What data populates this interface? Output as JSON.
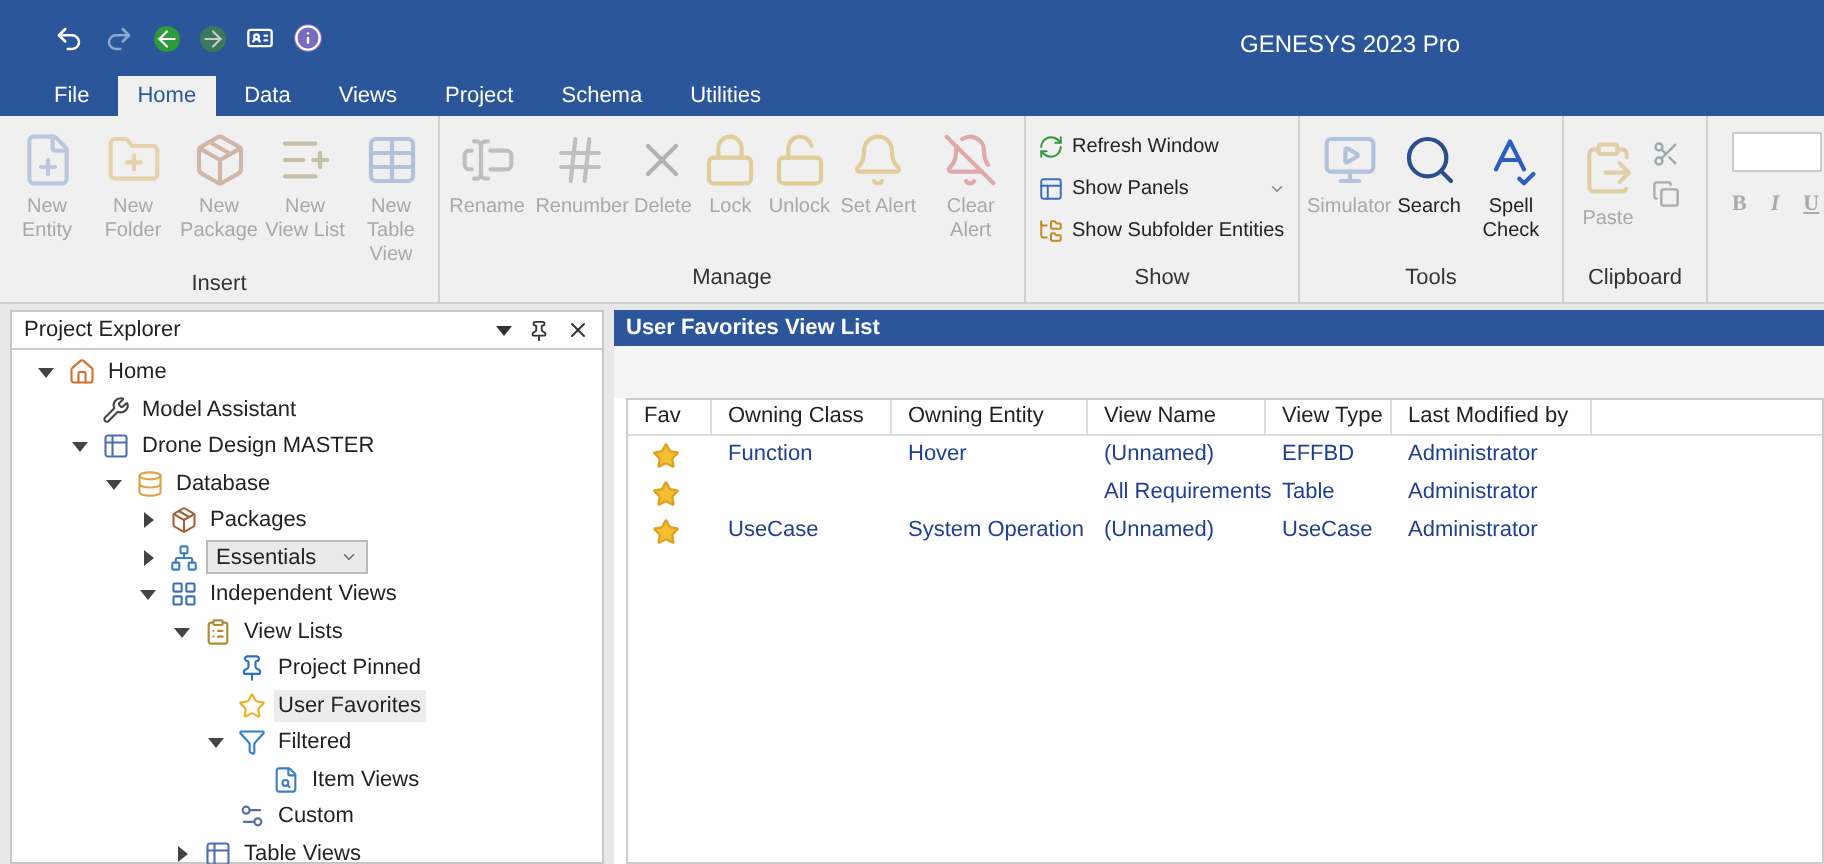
{
  "window": {
    "title": "GENESYS 2023 Pro"
  },
  "tabs": [
    {
      "label": "File",
      "selected": false
    },
    {
      "label": "Home",
      "selected": true
    },
    {
      "label": "Data",
      "selected": false
    },
    {
      "label": "Views",
      "selected": false
    },
    {
      "label": "Project",
      "selected": false
    },
    {
      "label": "Schema",
      "selected": false
    },
    {
      "label": "Utilities",
      "selected": false
    }
  ],
  "ribbon": {
    "groups": [
      {
        "title": "Insert",
        "kind": "large",
        "buttons": [
          {
            "label": "New Entity",
            "disabled": true
          },
          {
            "label": "New Folder",
            "disabled": true
          },
          {
            "label": "New Package",
            "disabled": true
          },
          {
            "label": "New View List",
            "disabled": true
          },
          {
            "label": "New Table View",
            "disabled": true
          }
        ]
      },
      {
        "title": "Manage",
        "kind": "large",
        "buttons": [
          {
            "label": "Rename",
            "disabled": true
          },
          {
            "label": "Renumber",
            "disabled": true
          },
          {
            "label": "Delete",
            "disabled": true
          },
          {
            "label": "Lock",
            "disabled": true
          },
          {
            "label": "Unlock",
            "disabled": true
          },
          {
            "label": "Set Alert",
            "disabled": true
          },
          {
            "label": "Clear Alert",
            "disabled": true
          }
        ]
      },
      {
        "title": "Show",
        "kind": "small",
        "buttons": [
          {
            "label": "Refresh Window",
            "disabled": false
          },
          {
            "label": "Show Panels",
            "disabled": false
          },
          {
            "label": "Show Subfolder Entities",
            "disabled": false
          }
        ]
      },
      {
        "title": "Tools",
        "kind": "large",
        "buttons": [
          {
            "label": "Simulator",
            "disabled": true
          },
          {
            "label": "Search",
            "disabled": false
          },
          {
            "label": "Spell Check",
            "disabled": false
          }
        ]
      },
      {
        "title": "Clipboard",
        "kind": "clipboard",
        "buttons": [
          {
            "label": "Paste",
            "disabled": true
          }
        ]
      }
    ],
    "format_buttons": [
      "B",
      "I",
      "U"
    ]
  },
  "explorer": {
    "title": "Project Explorer",
    "tree": [
      {
        "label": "Home",
        "expanded": true,
        "selected": false,
        "children": [
          {
            "label": "Model Assistant",
            "selected": false
          },
          {
            "label": "Drone Design MASTER",
            "expanded": true,
            "selected": false,
            "children": [
              {
                "label": "Database",
                "expanded": true,
                "selected": false,
                "children": [
                  {
                    "label": "Packages",
                    "expanded": false,
                    "selected": false
                  },
                  {
                    "label": "Essentials",
                    "kind": "combo",
                    "expanded": false,
                    "selected": false
                  },
                  {
                    "label": "Independent Views",
                    "expanded": true,
                    "selected": false,
                    "children": [
                      {
                        "label": "View Lists",
                        "expanded": true,
                        "selected": false,
                        "children": [
                          {
                            "label": "Project Pinned",
                            "selected": false
                          },
                          {
                            "label": "User Favorites",
                            "selected": true
                          },
                          {
                            "label": "Filtered",
                            "expanded": true,
                            "selected": false,
                            "children": [
                              {
                                "label": "Item Views",
                                "selected": false
                              }
                            ]
                          },
                          {
                            "label": "Custom",
                            "selected": false
                          }
                        ]
                      },
                      {
                        "label": "Table Views",
                        "expanded": false,
                        "selected": false
                      }
                    ]
                  }
                ]
              }
            ]
          }
        ]
      }
    ]
  },
  "view": {
    "title": "User Favorites View List",
    "columns": [
      "Fav",
      "Owning Class",
      "Owning Entity",
      "View Name",
      "View Type",
      "Last Modified by"
    ],
    "rows": [
      {
        "fav": true,
        "owning_class": "Function",
        "owning_entity": "Hover",
        "view_name": "(Unnamed)",
        "view_type": "EFFBD",
        "last_modified_by": "Administrator"
      },
      {
        "fav": true,
        "view_name": "All Requirements",
        "view_type": "Table",
        "last_modified_by": "Administrator"
      },
      {
        "fav": true,
        "owning_class": "UseCase",
        "owning_entity": "System Operation",
        "view_name": "(Unnamed)",
        "view_type": "UseCase",
        "last_modified_by": "Administrator"
      }
    ]
  }
}
